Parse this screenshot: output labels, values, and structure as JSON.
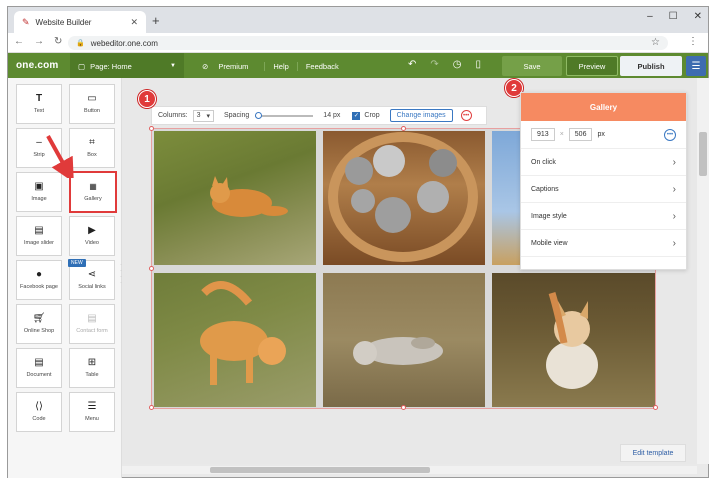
{
  "browser": {
    "tab_title": "Website Builder",
    "url": "webeditor.one.com"
  },
  "app": {
    "logo": "one.com",
    "page_label": "Page: Home",
    "menu": [
      "Premium",
      "Help",
      "Feedback"
    ],
    "save": "Save",
    "preview": "Preview",
    "publish": "Publish"
  },
  "sidebar": {
    "widgets": [
      "Text",
      "Button",
      "Strip",
      "Box",
      "Image",
      "Gallery",
      "Image slider",
      "Video",
      "Facebook page",
      "Social links",
      "Online Shop",
      "Contact form",
      "Document",
      "Table",
      "Code",
      "Menu"
    ],
    "new_badge": "NEW"
  },
  "toolbar": {
    "columns_label": "Columns:",
    "columns_value": "3",
    "spacing_label": "Spacing",
    "spacing_value": "14 px",
    "crop_label": "Crop",
    "crop_checked": true,
    "change_images": "Change images"
  },
  "steps": [
    "1",
    "2"
  ],
  "panel": {
    "title": "Gallery",
    "width": "913",
    "height": "506",
    "unit": "px",
    "rows": [
      "On click",
      "Captions",
      "Image style",
      "Mobile view"
    ]
  },
  "footer": {
    "edit_template": "Edit template"
  },
  "colors": {
    "green": "#5d8a30",
    "panel_header": "#f68a61",
    "accent_red": "#e03a3a",
    "blue": "#3a78c2"
  }
}
